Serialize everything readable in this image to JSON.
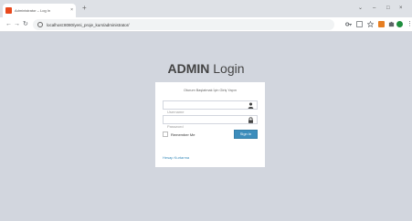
{
  "browser": {
    "tab_title": "Administrator – Log In",
    "tab_close": "×",
    "new_tab": "+",
    "url": "localhost:8080/yeni_proje_kurs/administrator/",
    "controls": {
      "chevron": "⌄",
      "minimize": "–",
      "maximize": "□",
      "close": "×"
    },
    "nav": {
      "back": "←",
      "forward": "→",
      "reload": "↻",
      "menu": "⋮"
    }
  },
  "login": {
    "logo_bold": "ADMIN",
    "logo_rest": " Login",
    "message": "Oturum Başlatmak İçin Giriş Yapın",
    "username_placeholder": "Username",
    "password_placeholder": "Password",
    "remember_label": "Remember Me",
    "signin_label": "Sign In",
    "forgot_link": "Hesap Kurtarma"
  },
  "colors": {
    "primary": "#3c8dbc",
    "background": "#d2d6de",
    "favicon": "#e8491d"
  },
  "icons": [
    "user-icon",
    "lock-icon",
    "info-icon",
    "key-icon",
    "star-icon",
    "puzzle-icon"
  ]
}
